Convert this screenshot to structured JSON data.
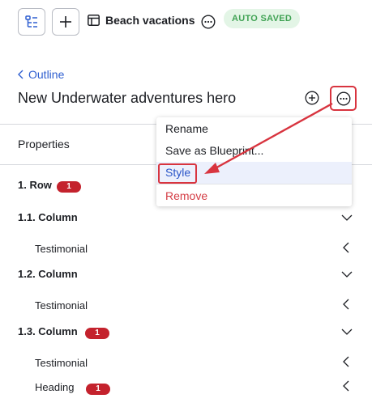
{
  "header": {
    "page_title": "Beach vacations",
    "save_status": "AUTO SAVED",
    "icons": {
      "outline": "outline-tree-icon",
      "add": "plus-icon",
      "page": "page-layout-icon",
      "more": "more-horizontal-icon"
    }
  },
  "breadcrumb": {
    "label": "Outline"
  },
  "item": {
    "title": "New Underwater adventures hero"
  },
  "tabs": {
    "properties": "Properties"
  },
  "context_menu": {
    "items": [
      {
        "label": "Rename"
      },
      {
        "label": "Save as Blueprint..."
      },
      {
        "label": "Style",
        "highlighted": true
      },
      {
        "label": "Remove",
        "destructive": true
      }
    ]
  },
  "tree": {
    "rows": [
      {
        "label": "1. Row",
        "badge": "1",
        "chevron": "down"
      },
      {
        "label": "1.1. Column",
        "chevron": "down"
      },
      {
        "label": "Testimonial",
        "chevron": "left"
      },
      {
        "label": "1.2. Column",
        "chevron": "down"
      },
      {
        "label": "Testimonial",
        "chevron": "left"
      },
      {
        "label": "1.3. Column",
        "badge": "1",
        "chevron": "down"
      },
      {
        "label": "Testimonial",
        "chevron": "left"
      },
      {
        "label": "Heading",
        "badge": "1",
        "chevron": "left"
      }
    ]
  },
  "colors": {
    "accent": "#2f5fd0",
    "annotation": "#d8343f",
    "badge": "#c4222d",
    "saved_bg": "#e3f5e6",
    "saved_text": "#41a355"
  }
}
